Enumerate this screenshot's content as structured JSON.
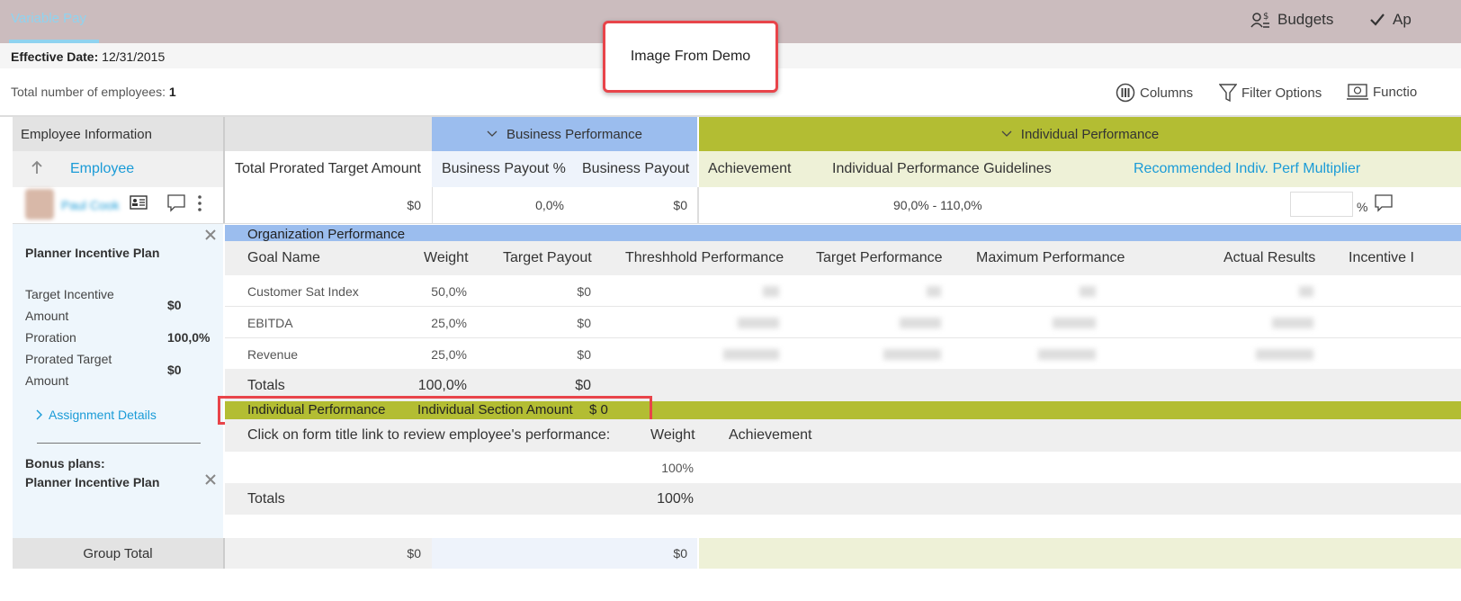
{
  "topbar": {
    "app_tab": "Variable Pay",
    "budgets_label": "Budgets",
    "approve_label": "Ap"
  },
  "effective": {
    "label": "Effective Date:",
    "value": "12/31/2015"
  },
  "total": {
    "label": "Total number of employees:",
    "value": "1"
  },
  "overlay": {
    "text": "Image From Demo"
  },
  "toolbar": {
    "columns_label": "Columns",
    "filter_label": "Filter Options",
    "functions_label": "Functio"
  },
  "groups": {
    "employee_info": "Employee Information",
    "business_performance": "Business Performance",
    "individual_performance": "Individual Performance"
  },
  "columns": {
    "employee": "Employee",
    "total_prorated": "Total Prorated Target Amount",
    "business_payout_pct": "Business Payout %",
    "business_payout": "Business Payout",
    "achievement": "Achievement",
    "guidelines": "Individual Performance Guidelines",
    "recommended": "Recommended Indiv. Perf Multiplier"
  },
  "employee_row": {
    "name": "Paul Cook",
    "total_prorated": "$0",
    "business_payout_pct": "0,0%",
    "business_payout": "$0",
    "guidelines": "90,0% - 110,0%",
    "pct_symbol": "%"
  },
  "left_panel": {
    "plan_title": "Planner Incentive Plan",
    "target_label_1": "Target Incentive",
    "target_label_2": "Amount",
    "target_value": "$0",
    "proration_label": "Proration",
    "proration_value": "100,0%",
    "prorated_label_1": "Prorated Target",
    "prorated_label_2": "Amount",
    "prorated_value": "$0",
    "assignment_details": "Assignment Details",
    "bonus_plans_label": "Bonus plans:",
    "bonus_plan_name": "Planner Incentive Plan"
  },
  "org": {
    "title": "Organization Performance",
    "headers": {
      "goal_name": "Goal Name",
      "weight": "Weight",
      "target_payout": "Target Payout",
      "threshold": "Threshhold Performance",
      "target_perf": "Target Performance",
      "max_perf": "Maximum Performance",
      "actual": "Actual Results",
      "incentive": "Incentive I"
    },
    "rows": [
      {
        "goal": "Customer Sat Index",
        "weight": "50,0%",
        "payout": "$0"
      },
      {
        "goal": "EBITDA",
        "weight": "25,0%",
        "payout": "$0"
      },
      {
        "goal": "Revenue",
        "weight": "25,0%",
        "payout": "$0"
      }
    ],
    "totals": {
      "label": "Totals",
      "weight": "100,0%",
      "payout": "$0"
    }
  },
  "individual": {
    "title": "Individual Performance",
    "section_amount_label": "Individual Section Amount",
    "section_amount_value": "$ 0",
    "instruction": "Click on form title link to review employee's performance:",
    "weight_label": "Weight",
    "achievement_label": "Achievement",
    "row_weight": "100%",
    "totals_label": "Totals",
    "totals_weight": "100%"
  },
  "group_total": {
    "label": "Group Total",
    "total_prorated": "$0",
    "business_payout": "$0"
  }
}
